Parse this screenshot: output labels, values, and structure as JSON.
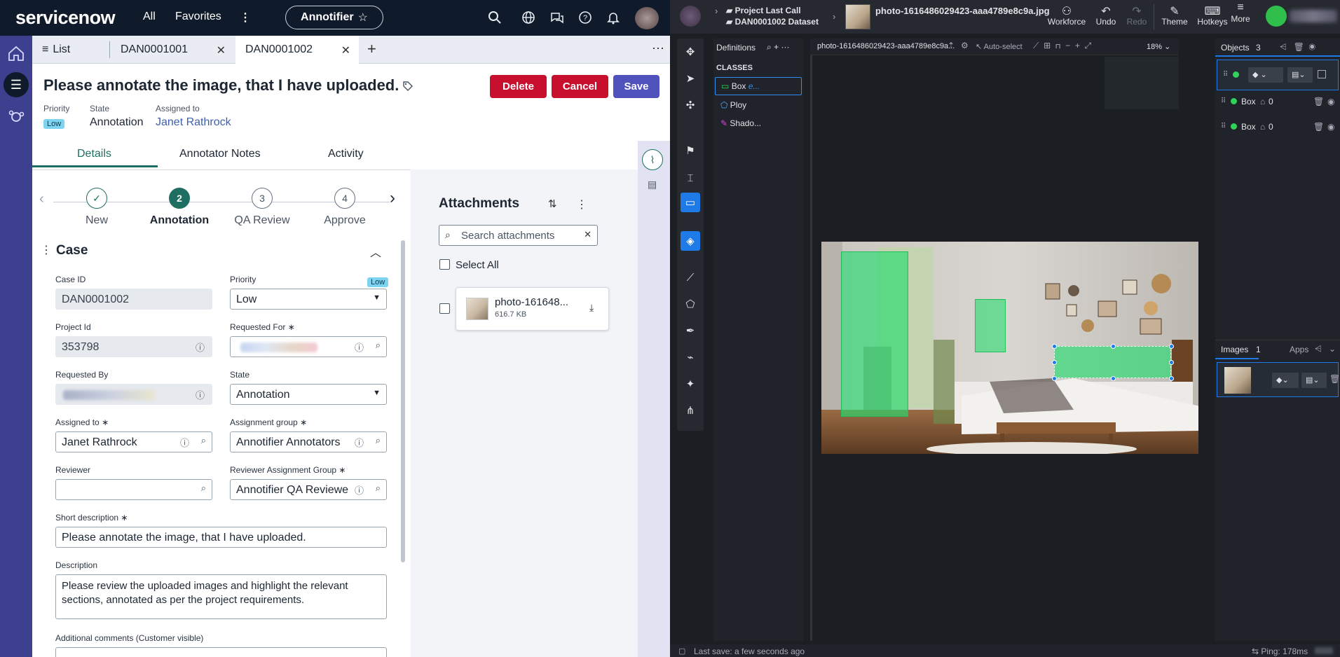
{
  "sn": {
    "logo": "servicenow",
    "nav": {
      "all": "All",
      "favorites": "Favorites",
      "app_pill": "Annotifier"
    },
    "tabs": {
      "list": "List",
      "tab1": "DAN0001001",
      "tab2": "DAN0001002"
    },
    "record": {
      "title": "Please annotate the image, that I have uploaded.",
      "delete": "Delete",
      "cancel": "Cancel",
      "save": "Save",
      "priority_label": "Priority",
      "priority_value": "Low",
      "state_label": "State",
      "state_value": "Annotation",
      "assigned_label": "Assigned to",
      "assigned_value": "Janet Rathrock"
    },
    "subtabs": {
      "details": "Details",
      "notes": "Annotator Notes",
      "activity": "Activity"
    },
    "steps": [
      {
        "num": "✓",
        "label": "New"
      },
      {
        "num": "2",
        "label": "Annotation"
      },
      {
        "num": "3",
        "label": "QA Review"
      },
      {
        "num": "4",
        "label": "Approve"
      }
    ],
    "form": {
      "section": "Case",
      "case_id_label": "Case ID",
      "case_id": "DAN0001002",
      "priority_label": "Priority",
      "priority_badge": "Low",
      "priority": "Low",
      "project_id_label": "Project Id",
      "project_id": "353798",
      "requested_for_label": "Requested For",
      "requested_by_label": "Requested By",
      "state_label": "State",
      "state": "Annotation",
      "assigned_to_label": "Assigned to",
      "assigned_to": "Janet Rathrock",
      "assignment_group_label": "Assignment group",
      "assignment_group": "Annotifier Annotators",
      "reviewer_label": "Reviewer",
      "reviewer": "",
      "reviewer_group_label": "Reviewer Assignment Group",
      "reviewer_group": "Annotifier QA Reviewe",
      "short_desc_label": "Short description",
      "short_desc": "Please annotate the image, that I have uploaded.",
      "desc_label": "Description",
      "desc_line1": "Please review the uploaded images and highlight the relevant",
      "desc_line2": "sections, annotated as per the project requirements.",
      "comments_label": "Additional comments (Customer visible)"
    },
    "attachments": {
      "title": "Attachments",
      "search_placeholder": "Search attachments",
      "select_all": "Select All",
      "file_name": "photo-161648...",
      "file_size": "616.7 KB"
    }
  },
  "at": {
    "breadcrumb_project": "Project Last Call",
    "breadcrumb_dataset": "DAN0001002 Dataset",
    "file_name": "photo-1616486029423-aaa4789e8c9a.jpg",
    "toolbar": {
      "workforce": "Workforce",
      "undo": "Undo",
      "redo": "Redo",
      "theme": "Theme",
      "hotkeys": "Hotkeys",
      "more": "More"
    },
    "definitions": "Definitions",
    "canvas_tab": "photo-1616486029423-aaa4789e8c9a...",
    "auto_select": "Auto-select",
    "zoom": "18%",
    "classes_label": "CLASSES",
    "classes": [
      {
        "name": "Box",
        "suffix": "e..."
      },
      {
        "name": "Ploy",
        "suffix": ""
      },
      {
        "name": "Shado...",
        "suffix": ""
      }
    ],
    "objects_label": "Objects",
    "objects_count": "3",
    "objects": [
      {
        "name": "Box",
        "count": "0"
      },
      {
        "name": "Box",
        "count": "0"
      }
    ],
    "images_label": "Images",
    "images_count": "1",
    "apps_label": "Apps",
    "status_left": "Last save: a few seconds ago",
    "status_right": "Ping: 178ms"
  }
}
